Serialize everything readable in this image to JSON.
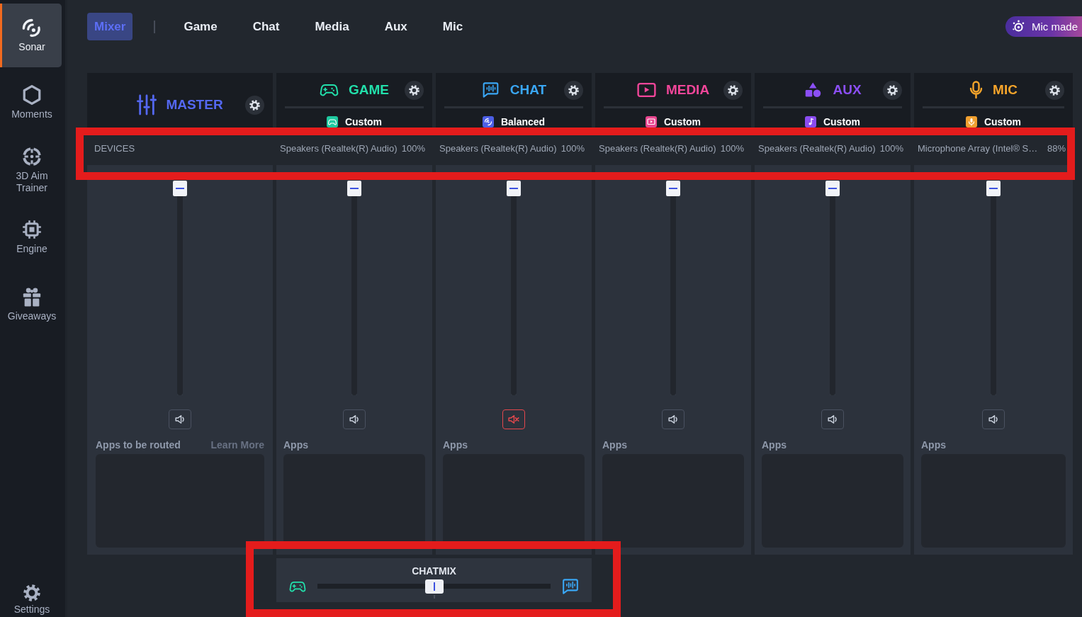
{
  "sidebar": {
    "items": [
      {
        "label": "Sonar",
        "selected": true
      },
      {
        "label": "Moments",
        "selected": false
      },
      {
        "label": "3D Aim Trainer",
        "selected": false
      },
      {
        "label": "Engine",
        "selected": false
      },
      {
        "label": "Giveaways",
        "selected": false
      }
    ],
    "footer": {
      "label": "Settings"
    }
  },
  "tabs": [
    {
      "label": "Mixer",
      "selected": true
    },
    {
      "label": "Game",
      "selected": false
    },
    {
      "label": "Chat",
      "selected": false
    },
    {
      "label": "Media",
      "selected": false
    },
    {
      "label": "Aux",
      "selected": false
    },
    {
      "label": "Mic",
      "selected": false
    }
  ],
  "promo_button": {
    "label": "Mic made"
  },
  "devices_row": {
    "highlighted": true
  },
  "channels": [
    {
      "kind": "master",
      "name": "MASTER",
      "color": "#5468f2",
      "devices_label": "DEVICES",
      "level": 1,
      "muted": false,
      "apps_label": "Apps to be routed",
      "apps_link": "Learn More"
    },
    {
      "kind": "channel",
      "name": "GAME",
      "color": "#22e0ab",
      "preset": {
        "label": "Custom",
        "color": "#1fc9a0"
      },
      "device": "Speakers (Realtek(R) Audio)",
      "device_level": "100%",
      "level": 1,
      "muted": false,
      "apps_label": "Apps"
    },
    {
      "kind": "channel",
      "name": "CHAT",
      "color": "#3aa7f5",
      "preset": {
        "label": "Balanced",
        "color": "#4c5fe6"
      },
      "device": "Speakers (Realtek(R) Audio)",
      "device_level": "100%",
      "level": 1,
      "muted": true,
      "apps_label": "Apps"
    },
    {
      "kind": "channel",
      "name": "MEDIA",
      "color": "#f2469a",
      "preset": {
        "label": "Custom",
        "color": "#e8468f"
      },
      "device": "Speakers (Realtek(R) Audio)",
      "device_level": "100%",
      "level": 1,
      "muted": false,
      "apps_label": "Apps"
    },
    {
      "kind": "channel",
      "name": "AUX",
      "color": "#8b4ff5",
      "preset": {
        "label": "Custom",
        "color": "#8a4cf0"
      },
      "device": "Speakers (Realtek(R) Audio)",
      "device_level": "100%",
      "level": 1,
      "muted": false,
      "apps_label": "Apps"
    },
    {
      "kind": "channel",
      "name": "MIC",
      "color": "#f7a52b",
      "preset": {
        "label": "Custom",
        "color": "#f0a030"
      },
      "device": "Microphone Array (Intel® S…",
      "device_level": "88%",
      "level": 1,
      "muted": false,
      "apps_label": "Apps"
    }
  ],
  "chatmix": {
    "label": "CHATMIX",
    "level": 0.5,
    "highlighted": true
  }
}
